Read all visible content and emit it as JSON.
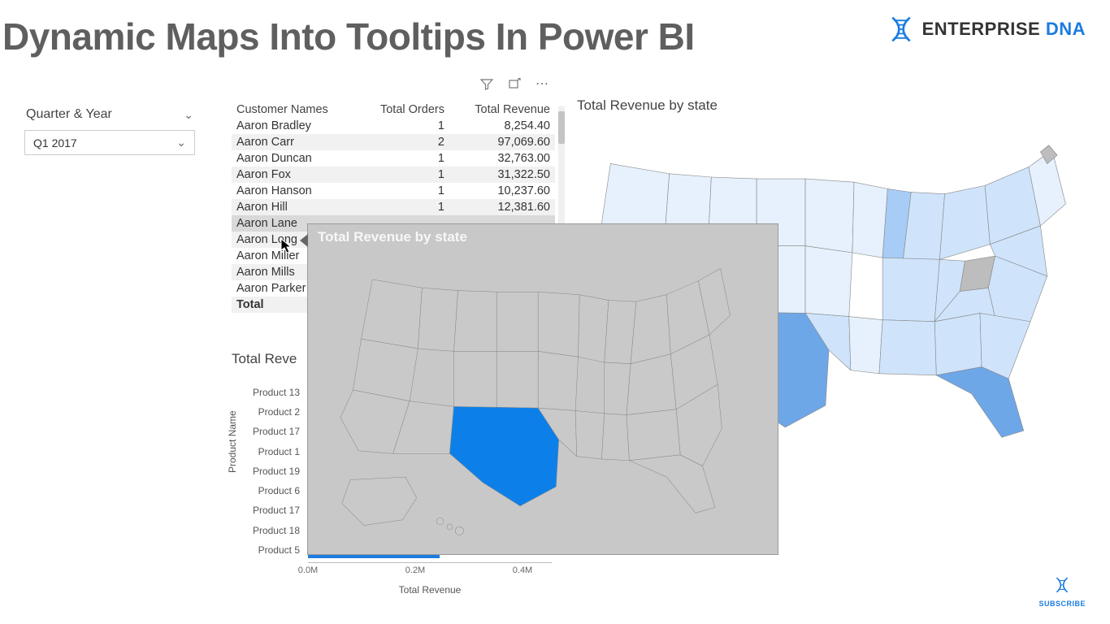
{
  "page_title": "Dynamic Maps Into Tooltips In Power BI",
  "brand": {
    "left": "ENTERPRISE",
    "right": "DNA"
  },
  "subscribe_label": "SUBSCRIBE",
  "slicer": {
    "label": "Quarter & Year",
    "value": "Q1 2017"
  },
  "table": {
    "columns": [
      "Customer Names",
      "Total Orders",
      "Total Revenue"
    ],
    "rows": [
      {
        "name": "Aaron Bradley",
        "orders": "1",
        "revenue": "8,254.40"
      },
      {
        "name": "Aaron Carr",
        "orders": "2",
        "revenue": "97,069.60"
      },
      {
        "name": "Aaron Duncan",
        "orders": "1",
        "revenue": "32,763.00"
      },
      {
        "name": "Aaron Fox",
        "orders": "1",
        "revenue": "31,322.50"
      },
      {
        "name": "Aaron Hanson",
        "orders": "1",
        "revenue": "10,237.60"
      },
      {
        "name": "Aaron Hill",
        "orders": "1",
        "revenue": "12,381.60"
      },
      {
        "name": "Aaron Lane",
        "orders": "",
        "revenue": ""
      },
      {
        "name": "Aaron Long",
        "orders": "",
        "revenue": ""
      },
      {
        "name": "Aaron Miller",
        "orders": "",
        "revenue": ""
      },
      {
        "name": "Aaron Mills",
        "orders": "",
        "revenue": ""
      },
      {
        "name": "Aaron Parker",
        "orders": "",
        "revenue": ""
      }
    ],
    "total_label": "Total",
    "highlight_row": 6
  },
  "map_title": "Total Revenue by state",
  "tooltip_title": "Total Revenue by state",
  "chart_data": {
    "type": "bar",
    "title": "Total Reve",
    "xlabel": "Total Revenue",
    "ylabel": "Product Name",
    "axis_ticks": [
      "0.0M",
      "0.2M",
      "0.4M"
    ],
    "xlim_M": 0.5,
    "bars": [
      {
        "label": "Product 13",
        "visibleM": 0.0
      },
      {
        "label": "Product 2",
        "visibleM": 0.0
      },
      {
        "label": "Product 17",
        "visibleM": 0.0
      },
      {
        "label": "Product 1",
        "visibleM": 0.0
      },
      {
        "label": "Product 19",
        "visibleM": 0.0
      },
      {
        "label": "Product 6",
        "visibleM": 0.0
      },
      {
        "label": "Product 17",
        "visibleM": 0.0
      },
      {
        "label": "Product 18",
        "visibleM": 0.0
      },
      {
        "label": "Product 5",
        "visibleM": 0.27
      }
    ]
  }
}
